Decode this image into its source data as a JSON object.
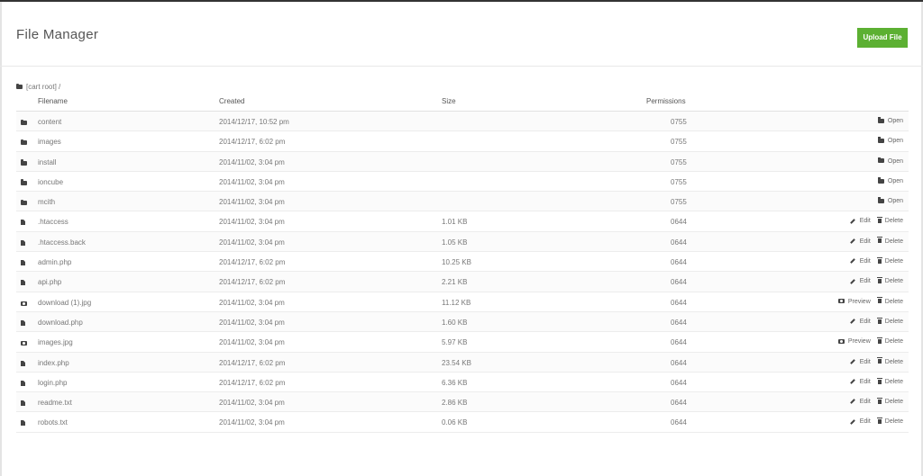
{
  "header": {
    "title": "File Manager",
    "upload_label": "Upload File"
  },
  "breadcrumb": {
    "text": "[cart root] /"
  },
  "columns": {
    "filename": "Filename",
    "created": "Created",
    "size": "Size",
    "permissions": "Permissions"
  },
  "actions": {
    "open": "Open",
    "edit": "Edit",
    "delete": "Delete",
    "preview": "Preview"
  },
  "rows": [
    {
      "icon": "folder-icon",
      "name": "content",
      "created": "2014/12/17, 10:52 pm",
      "size": "",
      "perm": "0755",
      "type": "folder"
    },
    {
      "icon": "folder-icon",
      "name": "images",
      "created": "2014/12/17, 6:02 pm",
      "size": "",
      "perm": "0755",
      "type": "folder"
    },
    {
      "icon": "folder-icon",
      "name": "install",
      "created": "2014/11/02, 3:04 pm",
      "size": "",
      "perm": "0755",
      "type": "folder"
    },
    {
      "icon": "folder-icon",
      "name": "ioncube",
      "created": "2014/11/02, 3:04 pm",
      "size": "",
      "perm": "0755",
      "type": "folder"
    },
    {
      "icon": "folder-icon",
      "name": "mcith",
      "created": "2014/11/02, 3:04 pm",
      "size": "",
      "perm": "0755",
      "type": "folder"
    },
    {
      "icon": "file-icon",
      "name": ".htaccess",
      "created": "2014/11/02, 3:04 pm",
      "size": "1.01 KB",
      "perm": "0644",
      "type": "file"
    },
    {
      "icon": "file-icon",
      "name": ".htaccess.back",
      "created": "2014/11/02, 3:04 pm",
      "size": "1.05 KB",
      "perm": "0644",
      "type": "file"
    },
    {
      "icon": "file-icon",
      "name": "admin.php",
      "created": "2014/12/17, 6:02 pm",
      "size": "10.25 KB",
      "perm": "0644",
      "type": "file"
    },
    {
      "icon": "file-icon",
      "name": "api.php",
      "created": "2014/12/17, 6:02 pm",
      "size": "2.21 KB",
      "perm": "0644",
      "type": "file"
    },
    {
      "icon": "camera-icon",
      "name": "download (1).jpg",
      "created": "2014/11/02, 3:04 pm",
      "size": "11.12 KB",
      "perm": "0644",
      "type": "image"
    },
    {
      "icon": "file-icon",
      "name": "download.php",
      "created": "2014/11/02, 3:04 pm",
      "size": "1.60 KB",
      "perm": "0644",
      "type": "file"
    },
    {
      "icon": "camera-icon",
      "name": "images.jpg",
      "created": "2014/11/02, 3:04 pm",
      "size": "5.97 KB",
      "perm": "0644",
      "type": "image"
    },
    {
      "icon": "file-icon",
      "name": "index.php",
      "created": "2014/12/17, 6:02 pm",
      "size": "23.54 KB",
      "perm": "0644",
      "type": "file"
    },
    {
      "icon": "file-icon",
      "name": "login.php",
      "created": "2014/12/17, 6:02 pm",
      "size": "6.36 KB",
      "perm": "0644",
      "type": "file"
    },
    {
      "icon": "file-icon",
      "name": "readme.txt",
      "created": "2014/11/02, 3:04 pm",
      "size": "2.86 KB",
      "perm": "0644",
      "type": "file"
    },
    {
      "icon": "file-icon",
      "name": "robots.txt",
      "created": "2014/11/02, 3:04 pm",
      "size": "0.06 KB",
      "perm": "0644",
      "type": "file"
    }
  ],
  "colors": {
    "accent": "#5cb032",
    "topbar": "#333333",
    "text": "#777777"
  }
}
